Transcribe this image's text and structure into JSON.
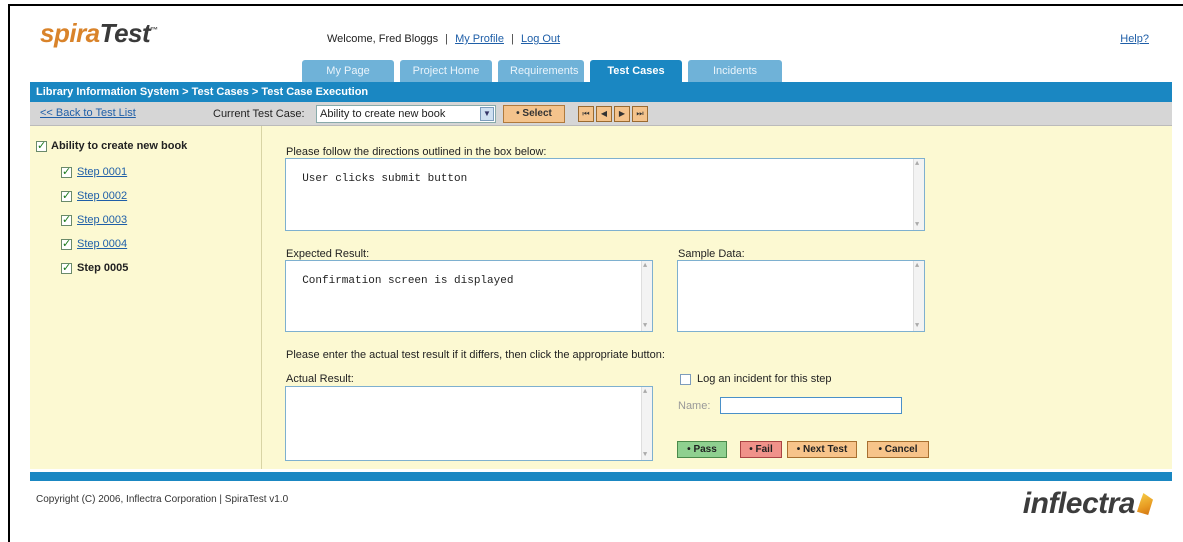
{
  "header": {
    "logo_part1": "spira",
    "logo_part2": "Test",
    "logo_tm": "™",
    "welcome_text": "Welcome, Fred Bloggs",
    "sep": "|",
    "my_profile": "My Profile",
    "log_out": "Log Out",
    "help": "Help?"
  },
  "tabs": [
    {
      "label": "My Page"
    },
    {
      "label": "Project Home"
    },
    {
      "label": "Requirements"
    },
    {
      "label": "Test Cases"
    },
    {
      "label": "Incidents"
    }
  ],
  "active_tab": "Test Cases",
  "breadcrumb": "Library Information System > Test Cases > Test Case Execution",
  "toolbar": {
    "back_link": "<< Back to Test List",
    "current_test_case_label": "Current Test Case:",
    "current_test_case_value": "Ability to create new book",
    "select_button": "• Select",
    "nav_first": "⏮",
    "nav_prev": "◀",
    "nav_next": "▶",
    "nav_last": "⏭"
  },
  "tree": {
    "root_label": "Ability to create new book",
    "steps": [
      {
        "label": "Step 0001",
        "checked": true
      },
      {
        "label": "Step 0002",
        "checked": true
      },
      {
        "label": "Step 0003",
        "checked": true
      },
      {
        "label": "Step 0004",
        "checked": true
      },
      {
        "label": "Step 0005",
        "checked": true,
        "current": true
      }
    ]
  },
  "form": {
    "directions_label": "Please follow the directions outlined in the box below:",
    "directions_value": "User clicks submit button",
    "expected_label": "Expected Result:",
    "expected_value": "Confirmation screen is displayed",
    "sample_label": "Sample Data:",
    "sample_value": "",
    "instruction": "Please enter the actual test result if it differs, then click the appropriate button:",
    "actual_label": "Actual Result:",
    "actual_value": "",
    "log_incident_label": "Log an incident for this step",
    "name_label": "Name:",
    "name_value": ""
  },
  "buttons": {
    "pass": "• Pass",
    "fail": "• Fail",
    "next_test": "• Next Test",
    "cancel": "• Cancel"
  },
  "footer": {
    "copyright": "Copyright (C) 2006, Inflectra Corporation | SpiraTest v1.0",
    "brand": "inflectra"
  },
  "colors": {
    "brand_blue": "#1a87c2",
    "tab_inactive": "#6fb2d8",
    "content_bg": "#fcf9d2",
    "pass_green": "#8fd08f",
    "fail_red": "#f0928a",
    "action_orange": "#f7c48a"
  }
}
